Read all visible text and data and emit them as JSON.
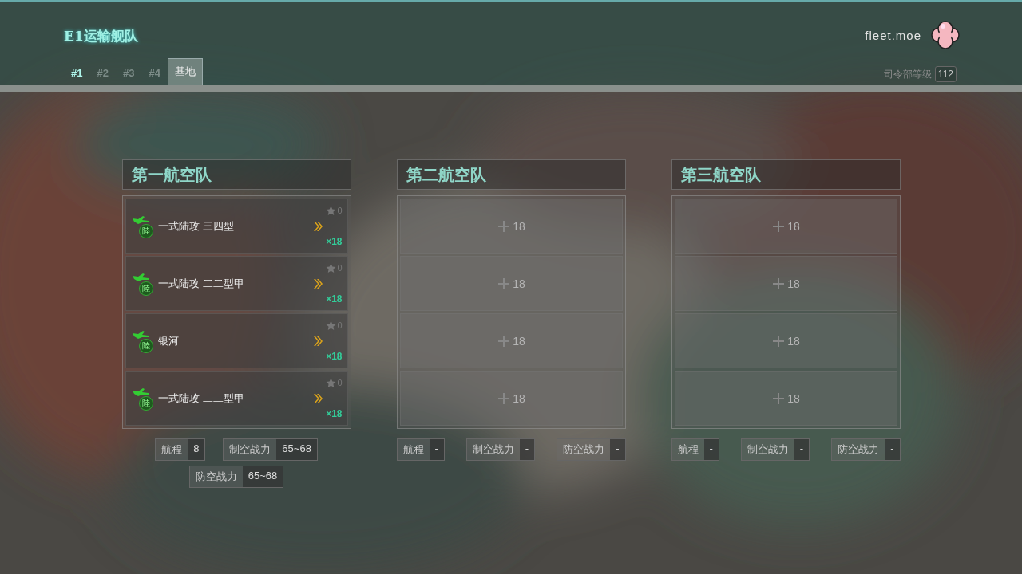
{
  "header": {
    "title": "E1运输舰队",
    "brand": "fleet.moe",
    "tabs": [
      {
        "label": "#1",
        "selected": false,
        "current": true
      },
      {
        "label": "#2",
        "selected": false,
        "current": false
      },
      {
        "label": "#3",
        "selected": false,
        "current": false
      },
      {
        "label": "#4",
        "selected": false,
        "current": false
      },
      {
        "label": "基地",
        "selected": true,
        "current": false
      }
    ],
    "hq_level": {
      "label": "司令部等级",
      "value": "112"
    }
  },
  "squadrons": [
    {
      "title": "第一航空队",
      "slots": [
        {
          "kind": "aircraft",
          "name": "一式陆攻 三四型",
          "badge": "陸",
          "stars_text": "0",
          "count": "×18"
        },
        {
          "kind": "aircraft",
          "name": "一式陆攻 二二型甲",
          "badge": "陸",
          "stars_text": "0",
          "count": "×18"
        },
        {
          "kind": "aircraft",
          "name": "银河",
          "badge": "陸",
          "stars_text": "0",
          "count": "×18"
        },
        {
          "kind": "aircraft",
          "name": "一式陆攻 二二型甲",
          "badge": "陸",
          "stars_text": "0",
          "count": "×18"
        }
      ],
      "stats": [
        {
          "label": "航程",
          "value": "8"
        },
        {
          "label": "制空战力",
          "value": "65~68"
        },
        {
          "label": "防空战力",
          "value": "65~68"
        }
      ]
    },
    {
      "title": "第二航空队",
      "slots": [
        {
          "kind": "empty",
          "count": "18"
        },
        {
          "kind": "empty",
          "count": "18"
        },
        {
          "kind": "empty",
          "count": "18"
        },
        {
          "kind": "empty",
          "count": "18"
        }
      ],
      "stats": [
        {
          "label": "航程",
          "value": "-"
        },
        {
          "label": "制空战力",
          "value": "-"
        },
        {
          "label": "防空战力",
          "value": "-"
        }
      ]
    },
    {
      "title": "第三航空队",
      "slots": [
        {
          "kind": "empty",
          "count": "18"
        },
        {
          "kind": "empty",
          "count": "18"
        },
        {
          "kind": "empty",
          "count": "18"
        },
        {
          "kind": "empty",
          "count": "18"
        }
      ],
      "stats": [
        {
          "label": "航程",
          "value": "-"
        },
        {
          "label": "制空战力",
          "value": "-"
        },
        {
          "label": "防空战力",
          "value": "-"
        }
      ]
    }
  ]
}
